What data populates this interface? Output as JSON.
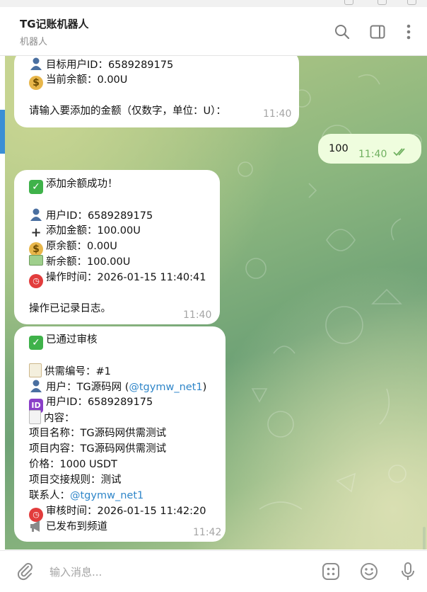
{
  "header": {
    "title": "TG记账机器人",
    "subtitle": "机器人"
  },
  "icons": {
    "search": "search-icon",
    "sidebar": "sidebar-toggle-icon",
    "more": "more-vertical-icon",
    "attach": "paperclip-icon",
    "commands": "bot-commands-icon",
    "emoji": "smiley-icon",
    "voice": "microphone-icon"
  },
  "colors": {
    "accent": "#3b8fd5",
    "link": "#2f86c9",
    "outgoing_bubble": "#effdde",
    "read_check": "#6fb05f"
  },
  "messages": {
    "m1": {
      "target_user": "目标用户ID：6589289175",
      "current_balance": "当前余额：0.00U",
      "prompt": "请输入要添加的金额（仅数字，单位：U）：",
      "time": "11:40"
    },
    "m2": {
      "text": "100",
      "time": "11:40"
    },
    "m3": {
      "success": "添加余额成功！",
      "user_id": "用户ID：6589289175",
      "added": "添加金额：100.00U",
      "old_balance": "原余额：0.00U",
      "new_balance": "新余额：100.00U",
      "op_time": "操作时间：2026-01-15 11:40:41",
      "logged": "操作已记录日志。",
      "time": "11:40"
    },
    "m4": {
      "approved": "已通过审核",
      "supply_no": "供需编号：#1",
      "user_prefix": "用户：TG源码网 (",
      "user_handle": "@tgymw_net1",
      "user_suffix": ")",
      "user_id": "用户ID：6589289175",
      "content_label": "内容：",
      "project_name": "项目名称：TG源码网供需测试",
      "project_content": "项目内容：TG源码网供需测试",
      "price": "价格：1000 USDT",
      "rules": "项目交接规则：测试",
      "contact_prefix": "联系人：",
      "contact_handle": "@tgymw_net1",
      "review_time": "审核时间：2026-01-15 11:42:20",
      "published": "已发布到频道",
      "time": "11:42"
    }
  },
  "input": {
    "placeholder": "输入消息..."
  }
}
